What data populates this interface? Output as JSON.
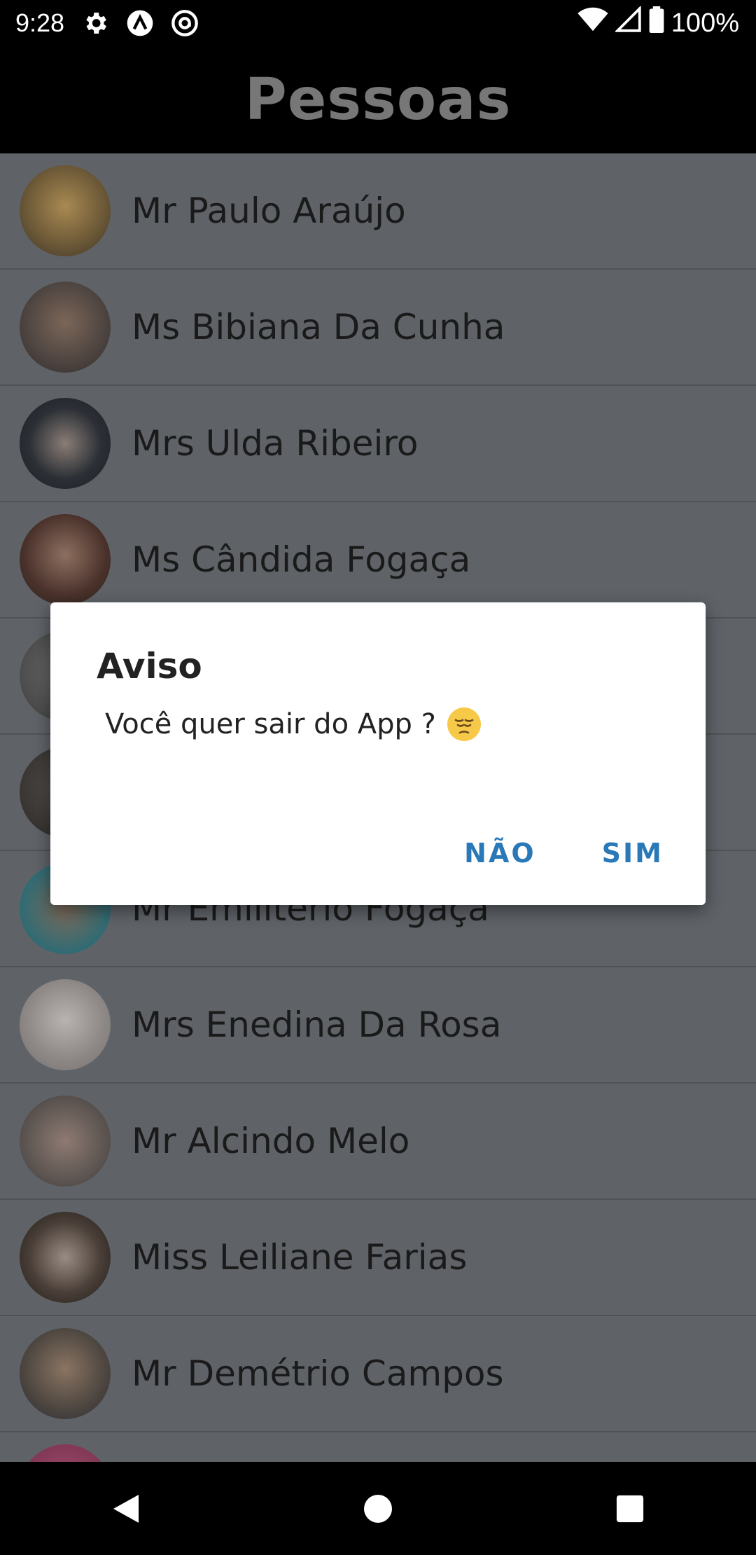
{
  "status_bar": {
    "time": "9:28",
    "battery": "100%",
    "icons": [
      "settings-icon",
      "app-a-icon",
      "at-sign-icon",
      "wifi-icon",
      "signal-icon",
      "battery-icon"
    ]
  },
  "app_bar": {
    "title": "Pessoas"
  },
  "people": [
    {
      "name": "Mr Paulo Araújo"
    },
    {
      "name": "Ms Bibiana Da Cunha"
    },
    {
      "name": "Mrs Ulda Ribeiro"
    },
    {
      "name": "Ms Cândida Fogaça"
    },
    {
      "name": ""
    },
    {
      "name": ""
    },
    {
      "name": "Mr Emiliterio Fogaça"
    },
    {
      "name": "Mrs Enedina Da Rosa"
    },
    {
      "name": "Mr Alcindo Melo"
    },
    {
      "name": "Miss Leiliane Farias"
    },
    {
      "name": "Mr Demétrio Campos"
    },
    {
      "name": ""
    }
  ],
  "dialog": {
    "title": "Aviso",
    "message": "Você quer sair do App ?",
    "emoji": "pensive-face-icon",
    "negative_label": "NÃO",
    "positive_label": "SIM"
  },
  "nav_bar": {
    "icons": [
      "back-icon",
      "home-icon",
      "recents-icon"
    ]
  },
  "colors": {
    "scrim_list": "#5f6368",
    "dialog_button": "#2979b9",
    "app_bar": "#000000"
  }
}
